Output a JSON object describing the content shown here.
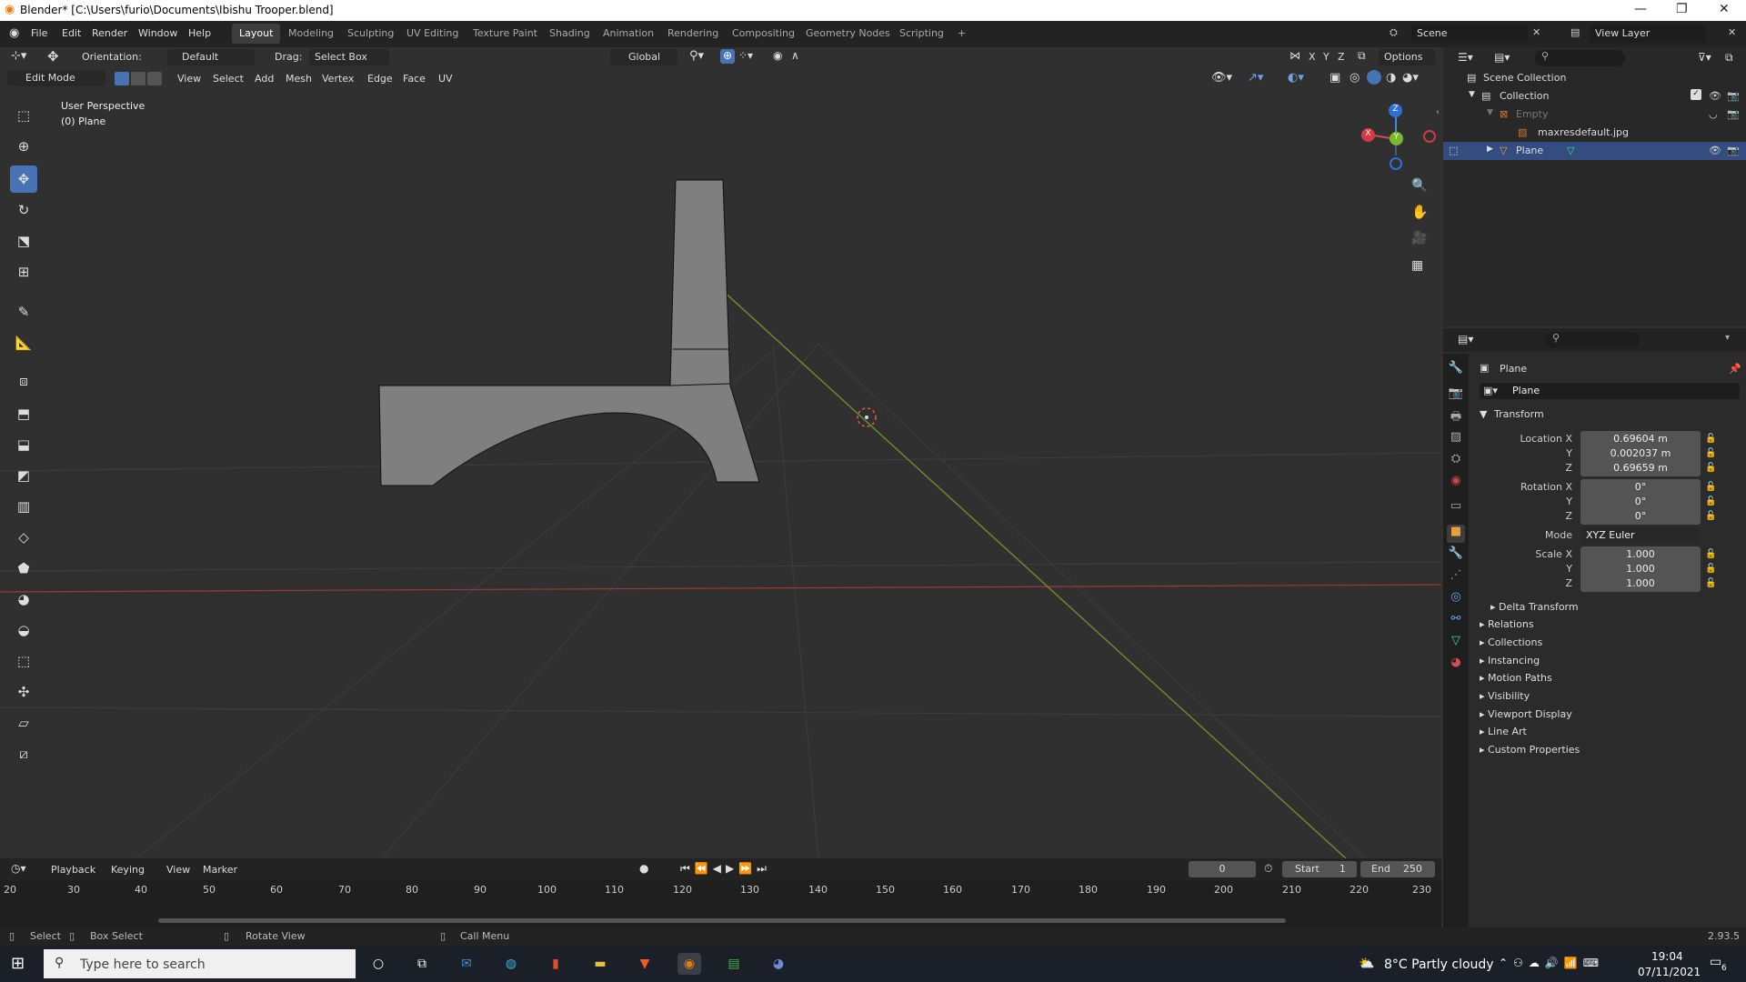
{
  "window": {
    "title": "Blender* [C:\\Users\\furio\\Documents\\Ibishu Trooper.blend]",
    "min": "—",
    "max": "❐",
    "close": "✕"
  },
  "menus": [
    "File",
    "Edit",
    "Render",
    "Window",
    "Help"
  ],
  "workspaces": [
    "Layout",
    "Modeling",
    "Sculpting",
    "UV Editing",
    "Texture Paint",
    "Shading",
    "Animation",
    "Rendering",
    "Compositing",
    "Geometry Nodes",
    "Scripting"
  ],
  "active_workspace": "Layout",
  "add_tab": "+",
  "scene": {
    "name": "Scene",
    "view_layer": "View Layer"
  },
  "tool_settings": {
    "orientation_label": "Orientation:",
    "orientation": "Default",
    "drag_label": "Drag:",
    "drag": "Select Box",
    "transform_orientation": "Global",
    "axes": [
      "X",
      "Y",
      "Z"
    ],
    "options": "Options"
  },
  "viewport_header": {
    "mode": "Edit Mode",
    "menus": [
      "View",
      "Select",
      "Add",
      "Mesh",
      "Vertex",
      "Edge",
      "Face",
      "UV"
    ]
  },
  "viewport": {
    "perspective": "User Perspective",
    "object": "(0) Plane",
    "gizmo_axes": [
      "X",
      "Y",
      "Z"
    ]
  },
  "outliner": {
    "items": [
      {
        "label": "Scene Collection",
        "level": 0
      },
      {
        "label": "Collection",
        "level": 1
      },
      {
        "label": "Empty",
        "level": 2
      },
      {
        "label": "maxresdefault.jpg",
        "level": 3
      },
      {
        "label": "Plane",
        "level": 2
      }
    ]
  },
  "properties": {
    "object_name": "Plane",
    "object_field": "Plane",
    "transform_title": "Transform",
    "location": {
      "label": "Location X",
      "x": "0.69604 m",
      "y": "0.002037 m",
      "z": "0.69659 m"
    },
    "rotation": {
      "label": "Rotation X",
      "x": "0°",
      "y": "0°",
      "z": "0°"
    },
    "mode_label": "Mode",
    "mode": "XYZ Euler",
    "scale": {
      "label": "Scale X",
      "x": "1.000",
      "y": "1.000",
      "z": "1.000"
    },
    "axis_y": "Y",
    "axis_z": "Z",
    "panels": [
      "Delta Transform",
      "Relations",
      "Collections",
      "Instancing",
      "Motion Paths",
      "Visibility",
      "Viewport Display",
      "Line Art",
      "Custom Properties"
    ]
  },
  "timeline": {
    "menus": [
      "Playback",
      "Keying",
      "View",
      "Marker"
    ],
    "current": "0",
    "start_label": "Start",
    "start": "1",
    "end_label": "End",
    "end": "250",
    "ticks": [
      "20",
      "30",
      "40",
      "50",
      "60",
      "70",
      "80",
      "90",
      "100",
      "110",
      "120",
      "130",
      "140",
      "150",
      "160",
      "170",
      "180",
      "190",
      "200",
      "210",
      "220",
      "230"
    ]
  },
  "statusbar": {
    "select": "Select",
    "box_select": "Box Select",
    "rotate": "Rotate View",
    "call_menu": "Call Menu",
    "version": "2.93.5"
  },
  "taskbar": {
    "search_placeholder": "Type here to search",
    "weather": "8°C  Partly cloudy",
    "time": "19:04",
    "date": "07/11/2021",
    "notif": "6"
  }
}
